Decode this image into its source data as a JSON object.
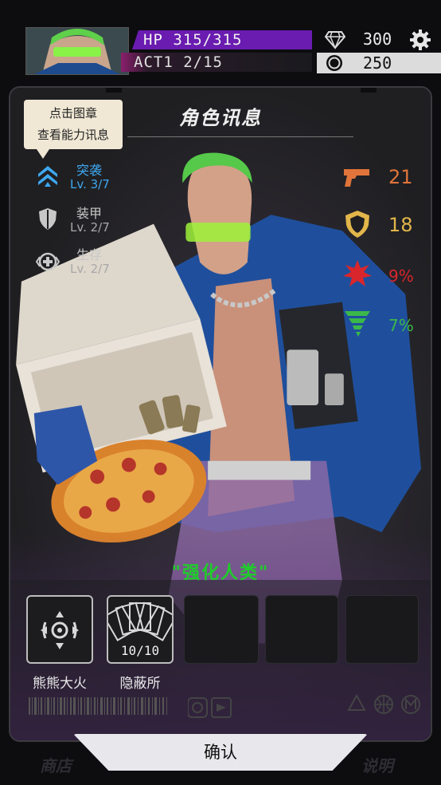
{
  "header": {
    "hp_text": "HP 315/315",
    "act_text": "ACT1 2/15",
    "gems": "300",
    "coins": "250"
  },
  "panel": {
    "title": "角色讯息",
    "tooltip_line1": "点击图章",
    "tooltip_line2": "查看能力讯息",
    "badges": [
      {
        "name": "突袭",
        "level": "Lv. 3/7",
        "icon": "assault-chevron-icon",
        "color": "#3ea8f0"
      },
      {
        "name": "装甲",
        "level": "Lv. 2/7",
        "icon": "armor-shield-icon",
        "color": "#c8c8c8"
      },
      {
        "name": "生存",
        "level": "Lv. 2/7",
        "icon": "survival-medkit-icon",
        "color": "#c8c8c8"
      }
    ],
    "stats": [
      {
        "icon": "pistol-icon",
        "value": "21",
        "color": "#e0743a"
      },
      {
        "icon": "shield-icon",
        "value": "18",
        "color": "#e2b64a"
      },
      {
        "icon": "crit-burst-icon",
        "value": "9%",
        "color": "#d9262c"
      },
      {
        "icon": "tornado-icon",
        "value": "7%",
        "color": "#3bb84a"
      }
    ],
    "perk": "\"强化人类\"",
    "slots": [
      {
        "label": "熊熊大火",
        "icon": "target-reticle-icon",
        "count": ""
      },
      {
        "label": "隐蔽所",
        "icon": "card-fan-icon",
        "count": "10/10"
      }
    ]
  },
  "footer": {
    "confirm": "确认",
    "left_ghost": "商店",
    "right_ghost": "说明"
  }
}
